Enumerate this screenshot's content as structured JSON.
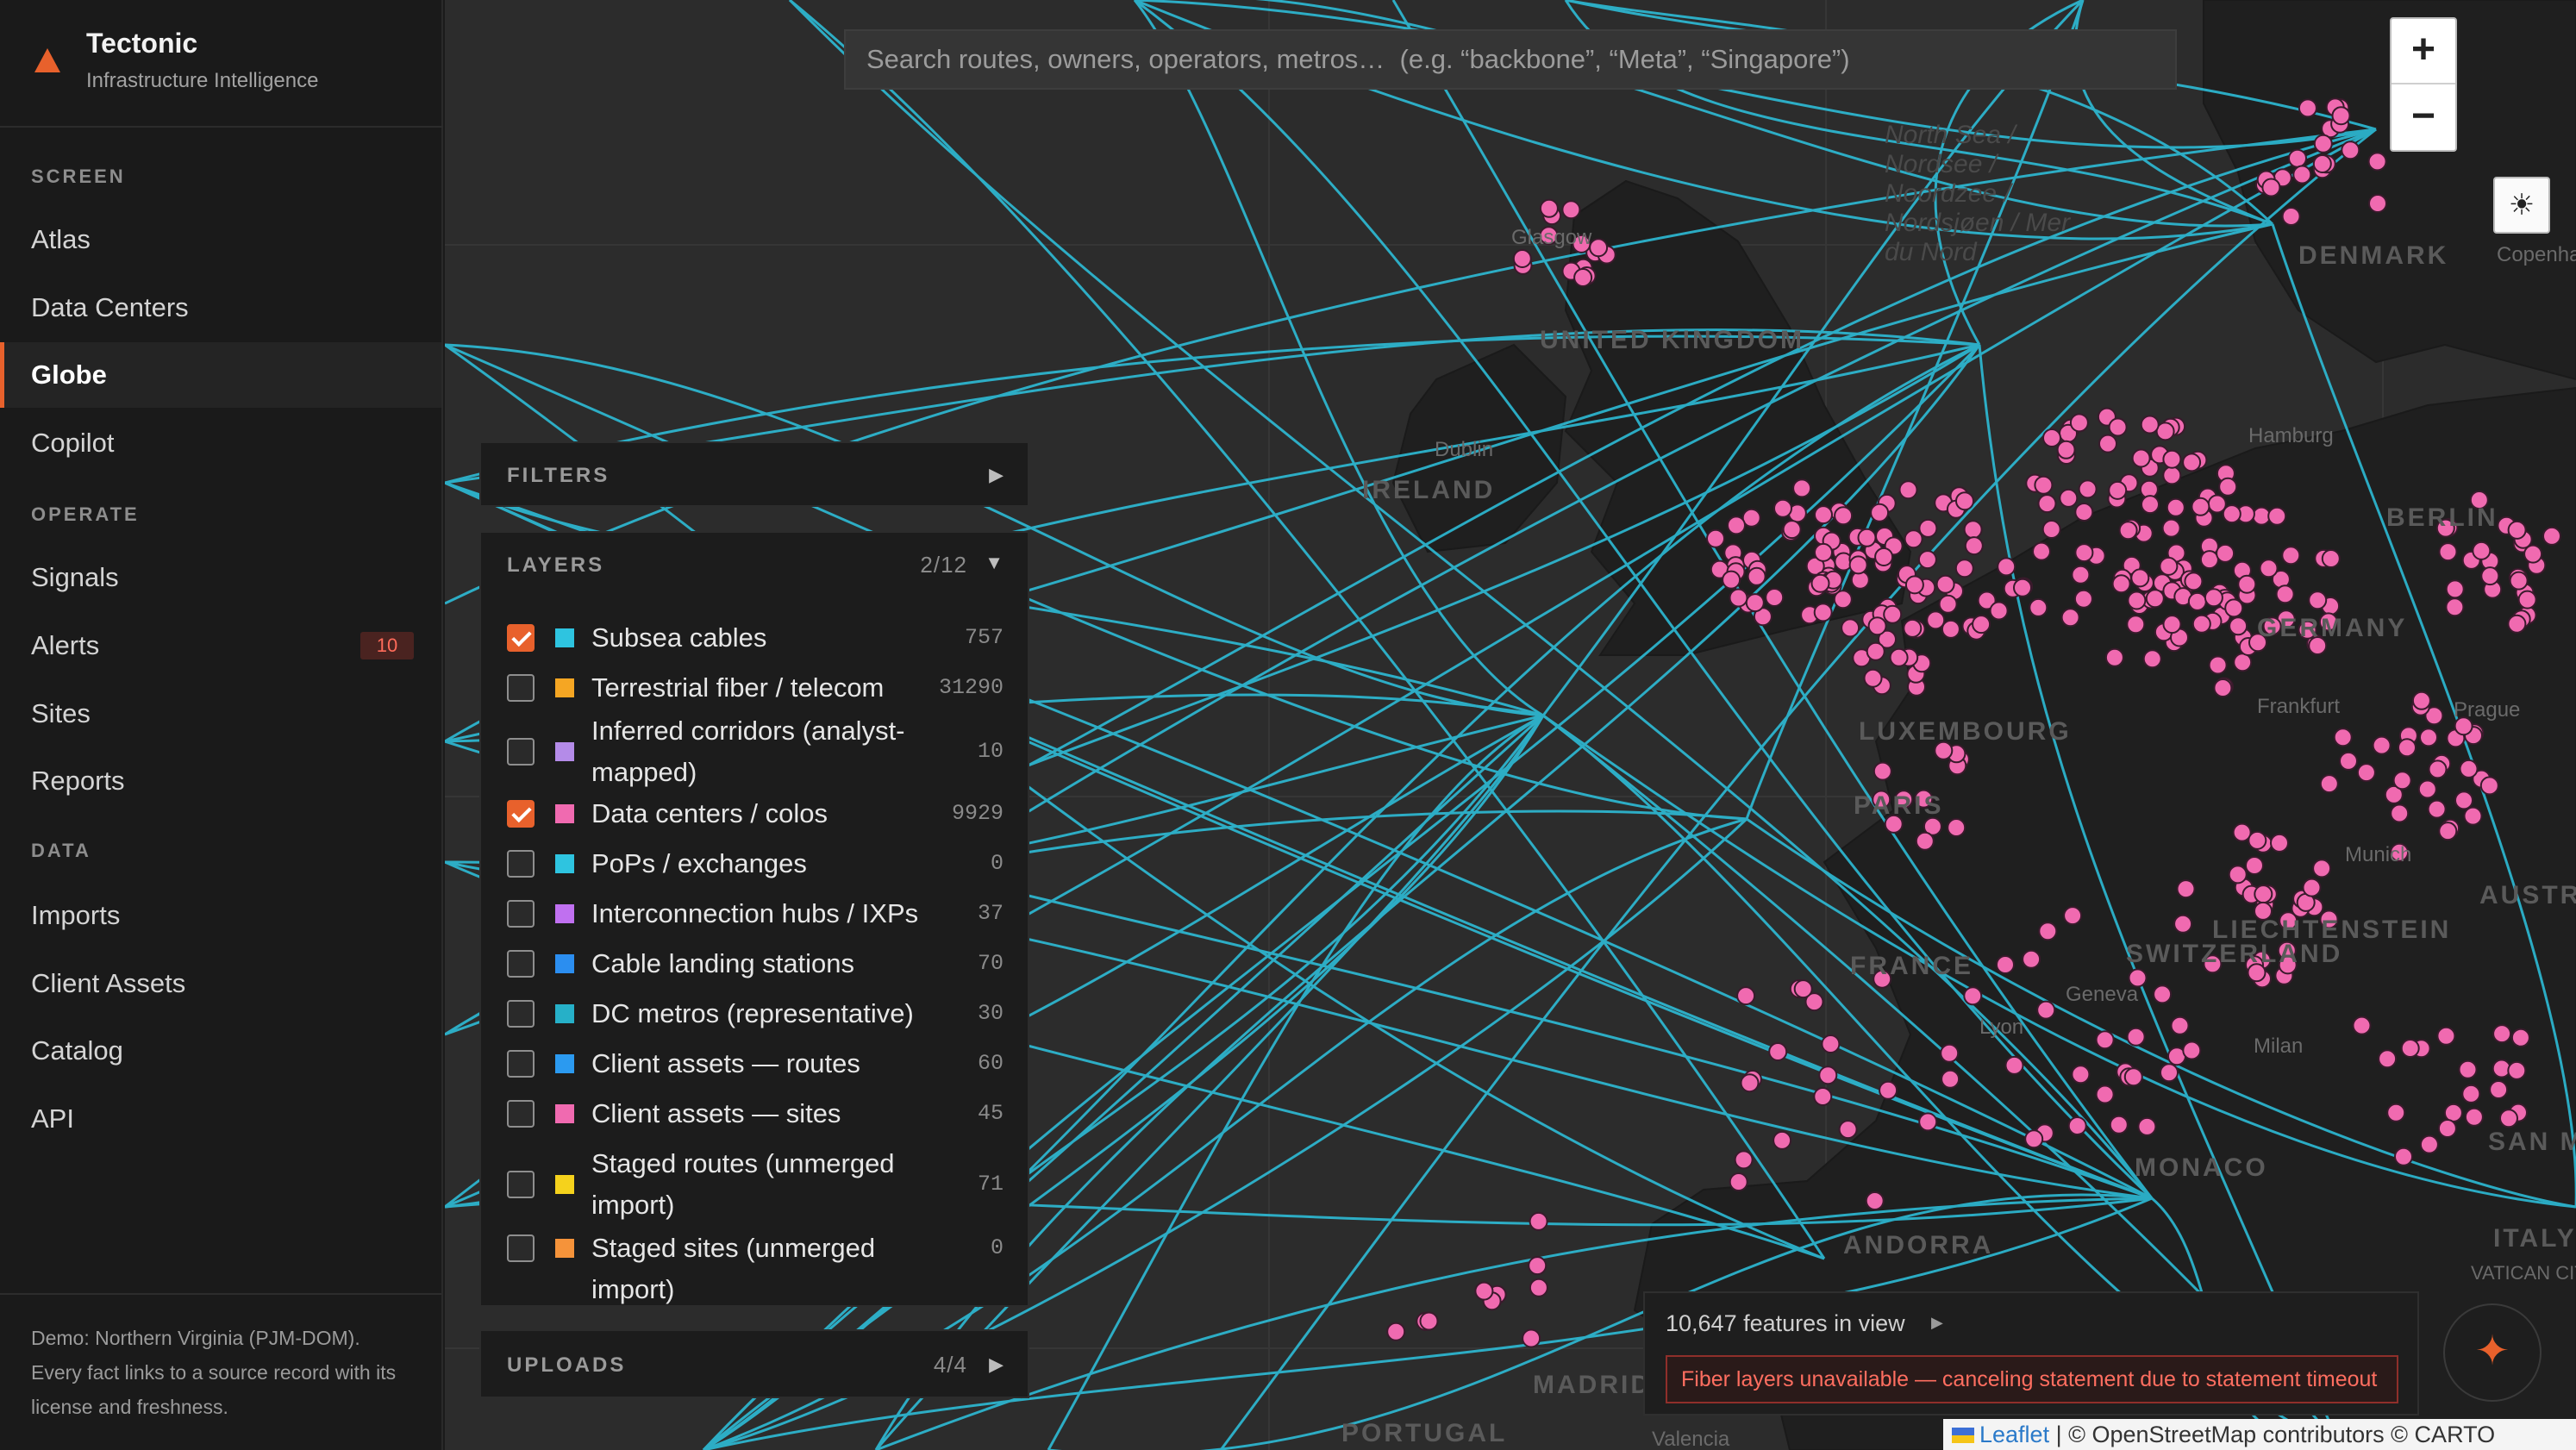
{
  "brand": {
    "name": "Tectonic",
    "subtitle": "Infrastructure Intelligence"
  },
  "nav": {
    "sections": [
      {
        "title": "SCREEN"
      },
      {
        "title": "OPERATE"
      },
      {
        "title": "DATA"
      }
    ],
    "items": [
      {
        "label": "Atlas"
      },
      {
        "label": "Data Centers"
      },
      {
        "label": "Globe",
        "active": true
      },
      {
        "label": "Copilot"
      },
      {
        "label": "Signals"
      },
      {
        "label": "Alerts",
        "badge": "10"
      },
      {
        "label": "Sites"
      },
      {
        "label": "Reports"
      },
      {
        "label": "Imports"
      },
      {
        "label": "Client Assets"
      },
      {
        "label": "Catalog"
      },
      {
        "label": "API"
      }
    ]
  },
  "footer_text": "Demo: Northern Virginia (PJM-DOM). Every fact links to a source record with its license and freshness.",
  "search": {
    "placeholder": "Search routes, owners, operators, metros…  (e.g. “backbone”, “Meta”, “Singapore”)"
  },
  "map_controls": {
    "zoom_in": "+",
    "zoom_out": "−",
    "theme_icon": "☀"
  },
  "filters": {
    "title": "FILTERS",
    "caret": "▶"
  },
  "layers": {
    "title": "LAYERS",
    "count": "2/12",
    "caret": "▼",
    "items": [
      {
        "label": "Subsea cables",
        "count": "757",
        "checked": true,
        "color": "#2ec4e0"
      },
      {
        "label": "Terrestrial fiber / telecom",
        "count": "31290",
        "checked": false,
        "color": "#f5a623"
      },
      {
        "label": "Inferred corridors (analyst-mapped)",
        "count": "10",
        "checked": false,
        "color": "#b48be8"
      },
      {
        "label": "Data centers / colos",
        "count": "9929",
        "checked": true,
        "color": "#f06ab0"
      },
      {
        "label": "PoPs / exchanges",
        "count": "0",
        "checked": false,
        "color": "#2ec4e0"
      },
      {
        "label": "Interconnection hubs / IXPs",
        "count": "37",
        "checked": false,
        "color": "#c070f0"
      },
      {
        "label": "Cable landing stations",
        "count": "70",
        "checked": false,
        "color": "#2b8ef0"
      },
      {
        "label": "DC metros (representative)",
        "count": "30",
        "checked": false,
        "color": "#26b0c8"
      },
      {
        "label": "Client assets — routes",
        "count": "60",
        "checked": false,
        "color": "#2b9af0"
      },
      {
        "label": "Client assets — sites",
        "count": "45",
        "checked": false,
        "color": "#f06ab0"
      },
      {
        "label": "Staged routes (unmerged import)",
        "count": "71",
        "checked": false,
        "color": "#f5d21c"
      },
      {
        "label": "Staged sites (unmerged import)",
        "count": "0",
        "checked": false,
        "color": "#f5933a"
      }
    ]
  },
  "uploads": {
    "title": "UPLOADS",
    "count": "4/4",
    "caret": "▶"
  },
  "status": {
    "features": "10,647 features in view",
    "caret": "▶",
    "error": "Fiber layers unavailable — canceling statement due to statement timeout"
  },
  "fab_icon": "✦",
  "attribution": {
    "leaflet": "Leaflet",
    "rest": " | © OpenStreetMap contributors © CARTO"
  },
  "map_labels": {
    "glasgow": "Glasgow",
    "uk": "UNITED KINGDOM",
    "dublin": "Dublin",
    "ireland": "IRELAND",
    "north_sea": "North Sea / Nordsee / Noordzee / Nordsjøen / Mer du Nord",
    "denmark": "DENMARK",
    "copenhagen": "Copenhagen",
    "hamburg": "Hamburg",
    "berlin": "BERLIN",
    "germany": "GERMANY",
    "luxembourg": "LUXEMBOURG",
    "frankfurt": "Frankfurt",
    "prague": "Prague",
    "paris": "PARIS",
    "munich": "Munich",
    "austria": "AUSTRIA",
    "liechtenstein": "LIECHTENSTEIN",
    "switzerland": "SWITZERLAND",
    "france": "FRANCE",
    "geneva": "Geneva",
    "lyon": "Lyon",
    "milan": "Milan",
    "san_marino": "SAN MARINO",
    "monaco": "MONACO",
    "italy": "ITALY",
    "vatican": "VATICAN CITY",
    "andorra": "ANDORRA",
    "madrid": "MADRID",
    "portugal": "PORTUGAL",
    "valencia": "Valencia"
  },
  "colors": {
    "accent": "#e8612c",
    "cable": "#2ec4e0",
    "dc": "#f06ab0",
    "land": "#1e1e1e",
    "sea": "#2c2c2c"
  }
}
